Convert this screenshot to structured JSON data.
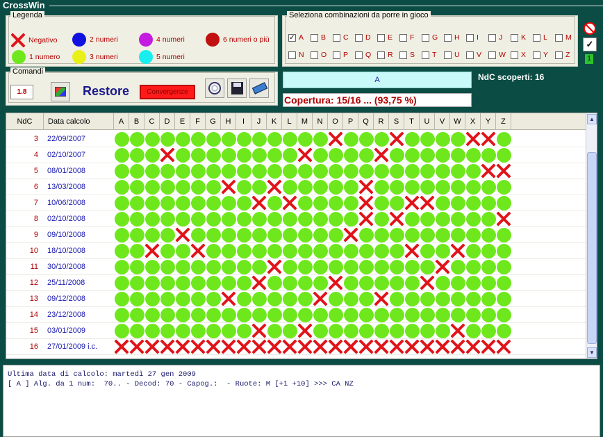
{
  "app": {
    "title": "CrossWin"
  },
  "legend": {
    "title": "Legenda",
    "items": [
      {
        "label": "Negativo",
        "kind": "x"
      },
      {
        "label": "2 numeri",
        "color": "#1010e0"
      },
      {
        "label": "4 numeri",
        "color": "#c41ce0"
      },
      {
        "label": "6 numeri o più",
        "color": "#c01010"
      },
      {
        "label": "1 numero",
        "color": "#6ee81c"
      },
      {
        "label": "3 numeri",
        "color": "#e8f018"
      },
      {
        "label": "5 numeri",
        "color": "#18eef0"
      }
    ]
  },
  "selection": {
    "title": "Seleziona combinazioni da porre in gioco",
    "row1": [
      "A",
      "B",
      "C",
      "D",
      "E",
      "F",
      "G",
      "H",
      "I",
      "J",
      "K",
      "L",
      "M"
    ],
    "row2": [
      "N",
      "O",
      "P",
      "Q",
      "R",
      "S",
      "T",
      "U",
      "V",
      "W",
      "X",
      "Y",
      "Z"
    ],
    "checked": [
      "A"
    ],
    "side_value": "1"
  },
  "commands": {
    "title": "Comandi",
    "num_button": "1.8",
    "restore_label": "Restore",
    "convergenze_label": "Convergenze"
  },
  "combo_display": "A",
  "ndc_scoperti": "NdC scoperti: 16",
  "copertura": "Copertura: 15/16 ... (93,75 %)",
  "grid": {
    "headers": [
      "NdC",
      "Data calcolo"
    ],
    "columns": [
      "A",
      "B",
      "C",
      "D",
      "E",
      "F",
      "G",
      "H",
      "I",
      "J",
      "K",
      "L",
      "M",
      "N",
      "O",
      "P",
      "Q",
      "R",
      "S",
      "T",
      "U",
      "V",
      "W",
      "X",
      "Y",
      "Z"
    ],
    "rows": [
      {
        "ndc": "3",
        "date": "22/09/2007",
        "x": [
          "O",
          "S",
          "X",
          "Y"
        ]
      },
      {
        "ndc": "4",
        "date": "02/10/2007",
        "x": [
          "D",
          "M",
          "R"
        ]
      },
      {
        "ndc": "5",
        "date": "08/01/2008",
        "x": [
          "Y",
          "Z"
        ]
      },
      {
        "ndc": "6",
        "date": "13/03/2008",
        "x": [
          "H",
          "K",
          "Q"
        ]
      },
      {
        "ndc": "7",
        "date": "10/06/2008",
        "x": [
          "J",
          "L",
          "Q",
          "T",
          "U"
        ]
      },
      {
        "ndc": "8",
        "date": "02/10/2008",
        "x": [
          "Q",
          "S",
          "Z"
        ]
      },
      {
        "ndc": "9",
        "date": "09/10/2008",
        "x": [
          "E",
          "P"
        ]
      },
      {
        "ndc": "10",
        "date": "18/10/2008",
        "x": [
          "C",
          "F",
          "T",
          "W"
        ]
      },
      {
        "ndc": "11",
        "date": "30/10/2008",
        "x": [
          "K",
          "V"
        ]
      },
      {
        "ndc": "12",
        "date": "25/11/2008",
        "x": [
          "J",
          "O",
          "U"
        ]
      },
      {
        "ndc": "13",
        "date": "09/12/2008",
        "x": [
          "H",
          "N",
          "R"
        ]
      },
      {
        "ndc": "14",
        "date": "23/12/2008",
        "x": []
      },
      {
        "ndc": "15",
        "date": "03/01/2009",
        "x": [
          "J",
          "M",
          "W"
        ]
      },
      {
        "ndc": "16",
        "date": "27/01/2009 i.c.",
        "x": [
          "A",
          "B",
          "C",
          "D",
          "E",
          "F",
          "G",
          "H",
          "I",
          "J",
          "K",
          "L",
          "M",
          "N",
          "O",
          "P",
          "Q",
          "R",
          "S",
          "T",
          "U",
          "V",
          "W",
          "X",
          "Y",
          "Z"
        ]
      }
    ]
  },
  "log": {
    "lines": [
      "Ultima data di calcolo: martedì 27 gen 2009",
      "",
      "[ A ] Alg. da 1 num:  70.. - Decod: 70 - Capog.:  - Ruote: M [+1 +10] >>> CA NZ"
    ]
  }
}
